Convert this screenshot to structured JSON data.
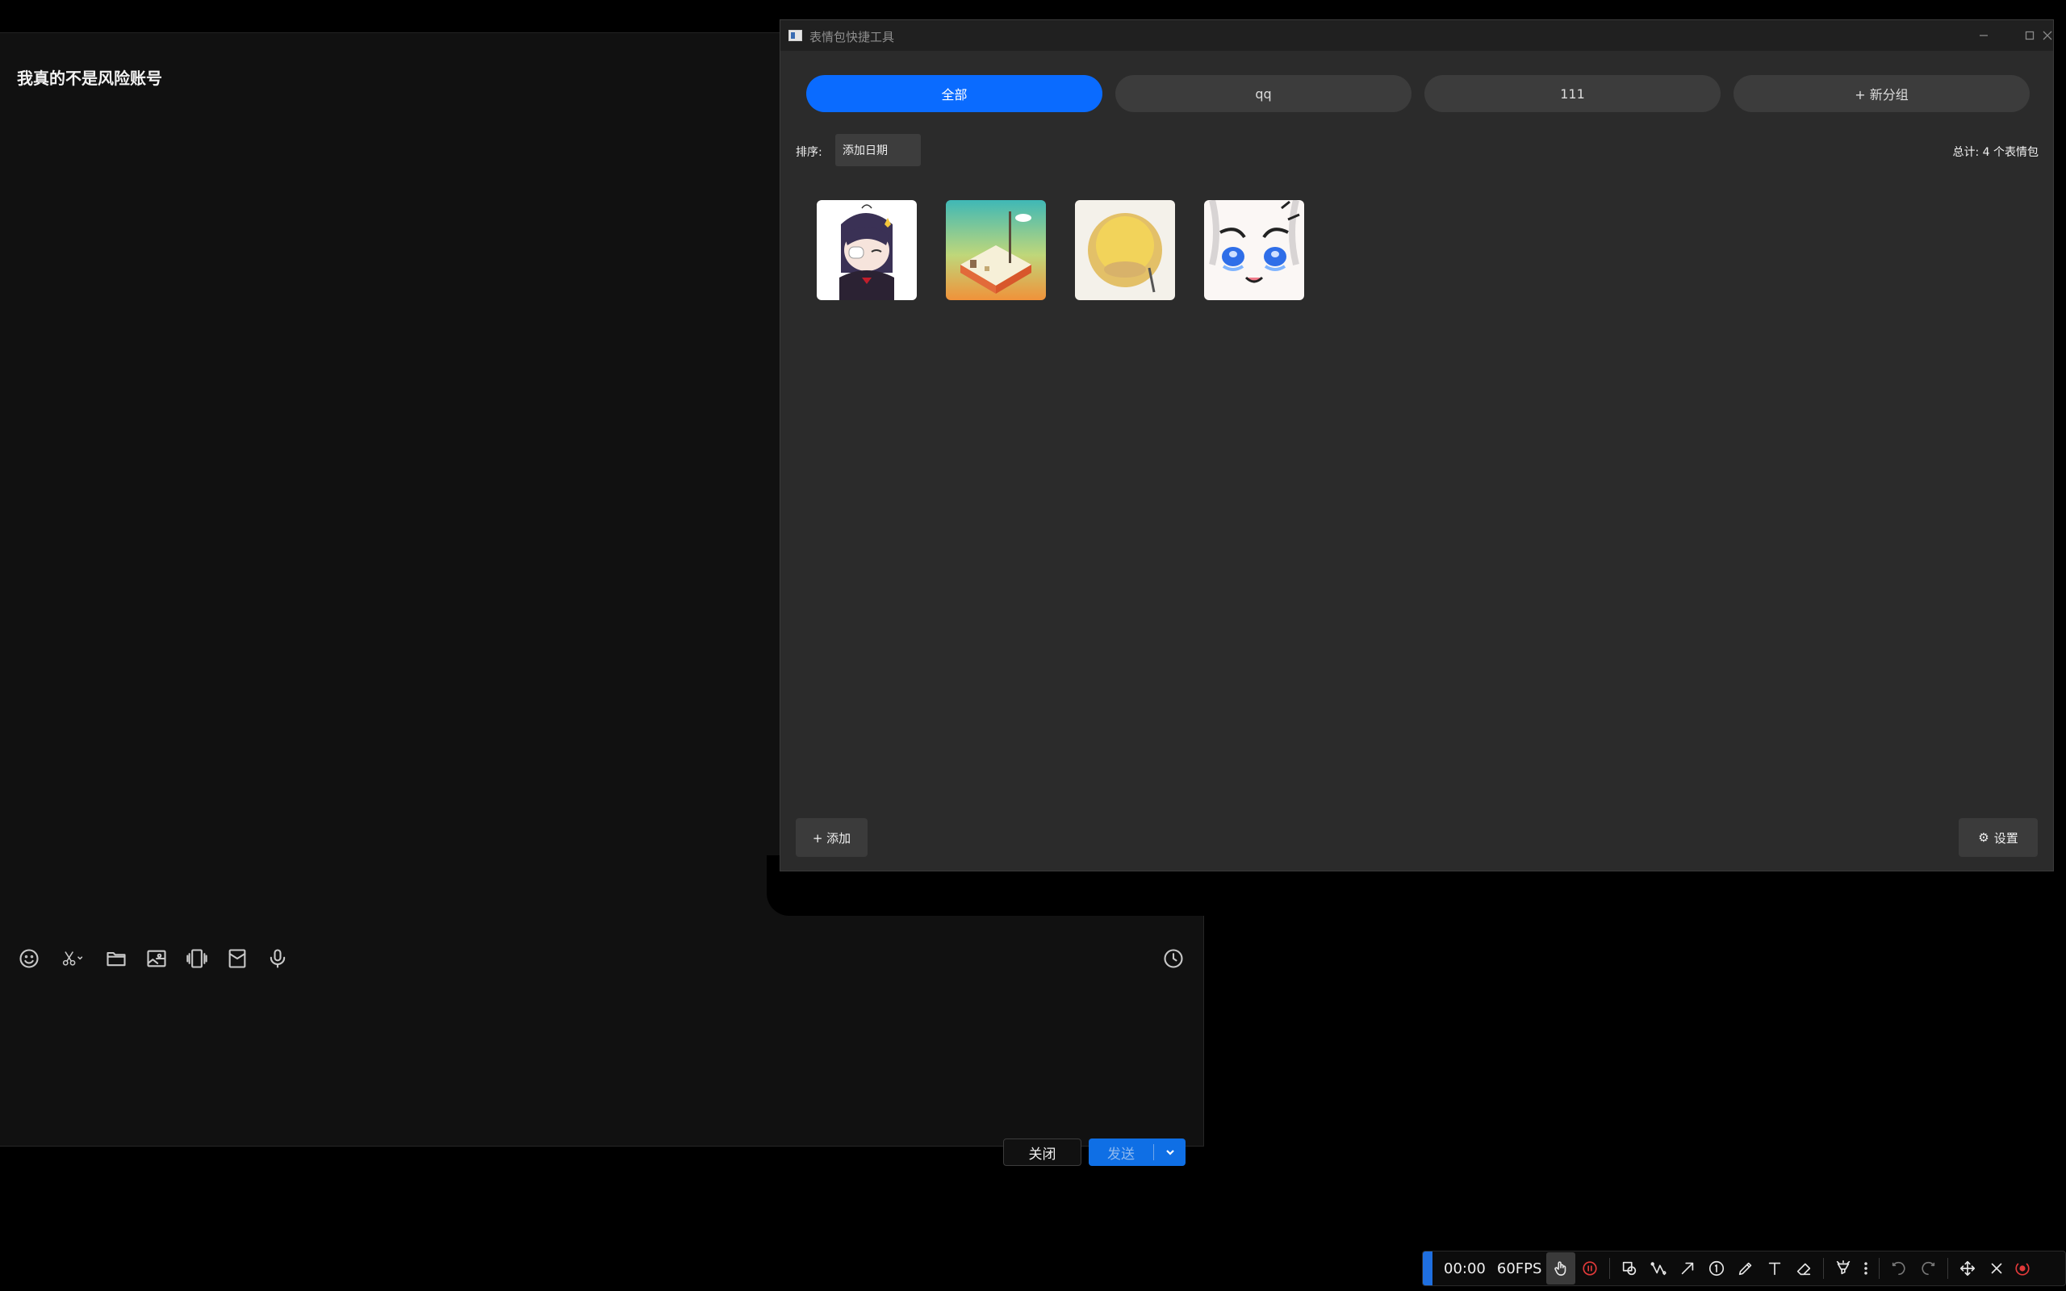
{
  "chat": {
    "title": "我真的不是风险账号",
    "toolbar_icons": [
      "emoji-icon",
      "scissors-icon",
      "folder-icon",
      "image-icon",
      "shake-icon",
      "gift-box-icon",
      "microphone-icon"
    ],
    "close_label": "关闭",
    "send_label": "发送"
  },
  "emoji_window": {
    "title": "表情包快捷工具",
    "tabs": [
      {
        "label": "全部",
        "active": true
      },
      {
        "label": "qq",
        "active": false
      },
      {
        "label": "111",
        "active": false
      },
      {
        "label": "+ 新分组",
        "active": false
      }
    ],
    "sort_label": "排序:",
    "sort_value": "添加日期",
    "total": "总计: 4 个表情包",
    "stickers": [
      "anime-girl-eyepatch",
      "desert-pixel-scene",
      "blurry-yellow-emoji",
      "crying-white-hair-girl"
    ],
    "add_label": "+ 添加",
    "settings_label": "设置"
  },
  "recorder": {
    "time": "00:00",
    "fps": "60FPS"
  },
  "colors": {
    "accent": "#0a6bff",
    "send": "#0f6fe5",
    "window_bg": "#2b2b2b",
    "chat_bg": "#111111"
  }
}
